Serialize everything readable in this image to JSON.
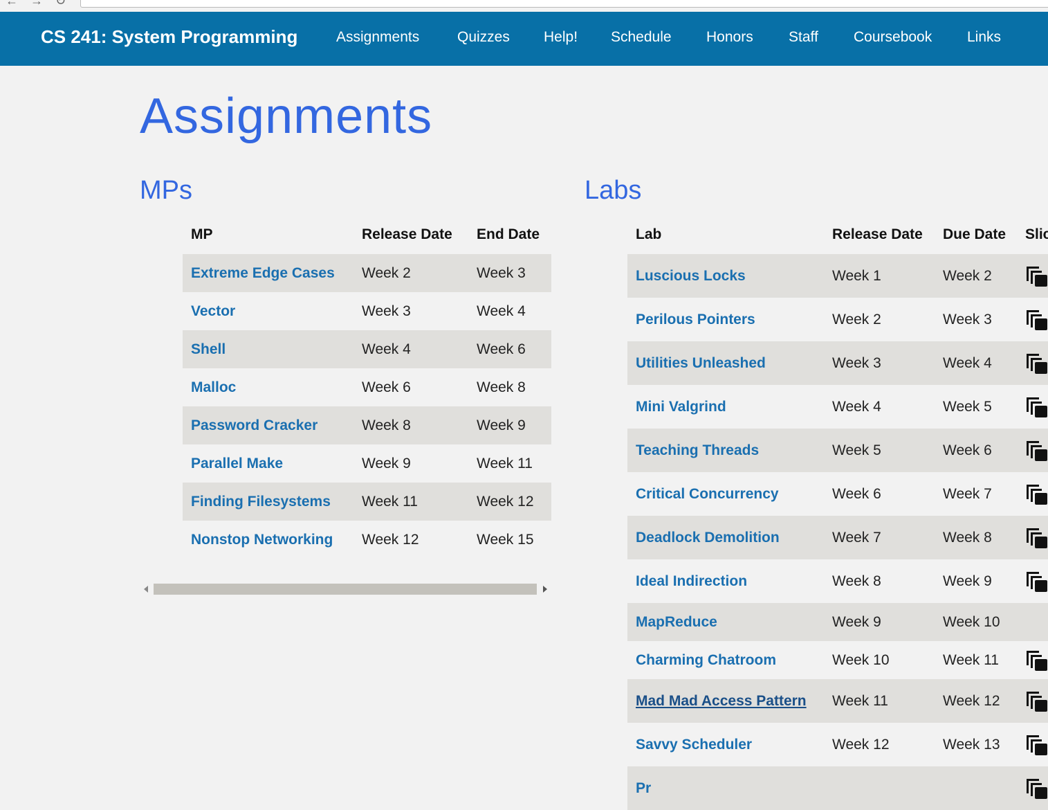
{
  "nav": {
    "brand": "CS 241: System Programming",
    "links": [
      "Assignments",
      "Quizzes",
      "Help!",
      "Schedule",
      "Honors",
      "Staff",
      "Coursebook",
      "Links"
    ]
  },
  "page": {
    "title": "Assignments"
  },
  "mps": {
    "heading": "MPs",
    "columns": [
      "MP",
      "Release Date",
      "End Date"
    ],
    "rows": [
      {
        "name": "Extreme Edge Cases",
        "release": "Week 2",
        "end": "Week 3"
      },
      {
        "name": "Vector",
        "release": "Week 3",
        "end": "Week 4"
      },
      {
        "name": "Shell",
        "release": "Week 4",
        "end": "Week 6"
      },
      {
        "name": "Malloc",
        "release": "Week 6",
        "end": "Week 8"
      },
      {
        "name": "Password Cracker",
        "release": "Week 8",
        "end": "Week 9"
      },
      {
        "name": "Parallel Make",
        "release": "Week 9",
        "end": "Week 11"
      },
      {
        "name": "Finding Filesystems",
        "release": "Week 11",
        "end": "Week 12"
      },
      {
        "name": "Nonstop Networking",
        "release": "Week 12",
        "end": "Week 15"
      }
    ]
  },
  "labs": {
    "heading": "Labs",
    "columns": [
      "Lab",
      "Release Date",
      "Due Date",
      "Slic"
    ],
    "rows": [
      {
        "name": "Luscious Locks",
        "release": "Week 1",
        "due": "Week 2",
        "slides_icon": "slides-icon"
      },
      {
        "name": "Perilous Pointers",
        "release": "Week 2",
        "due": "Week 3",
        "slides_icon": "slides-icon"
      },
      {
        "name": "Utilities Unleashed",
        "release": "Week 3",
        "due": "Week 4",
        "slides_icon": "slides-icon"
      },
      {
        "name": "Mini Valgrind",
        "release": "Week 4",
        "due": "Week 5",
        "slides_icon": "slides-icon"
      },
      {
        "name": "Teaching Threads",
        "release": "Week 5",
        "due": "Week 6",
        "slides_icon": "slides-icon"
      },
      {
        "name": "Critical Concurrency",
        "release": "Week 6",
        "due": "Week 7",
        "slides_icon": "slides-icon"
      },
      {
        "name": "Deadlock Demolition",
        "release": "Week 7",
        "due": "Week 8",
        "slides_icon": "slides-icon"
      },
      {
        "name": "Ideal Indirection",
        "release": "Week 8",
        "due": "Week 9",
        "slides_icon": "slides-icon"
      },
      {
        "name": "MapReduce",
        "release": "Week 9",
        "due": "Week 10",
        "slides_icon": null
      },
      {
        "name": "Charming Chatroom",
        "release": "Week 10",
        "due": "Week 11",
        "slides_icon": "slides-icon"
      },
      {
        "name": "Mad Mad Access Pattern",
        "release": "Week 11",
        "due": "Week 12",
        "slides_icon": "slides-icon",
        "hovered": true
      },
      {
        "name": "Savvy Scheduler",
        "release": "Week 12",
        "due": "Week 13",
        "slides_icon": "slides-icon"
      },
      {
        "name": "Pr",
        "release": "",
        "due": "",
        "slides_icon": "slides-icon"
      }
    ]
  },
  "colors": {
    "navbar": "#0870a7",
    "heading": "#3367e0",
    "link": "#1a6fb0",
    "row_alt": "#e0dfdc",
    "background": "#f2f2f2"
  }
}
